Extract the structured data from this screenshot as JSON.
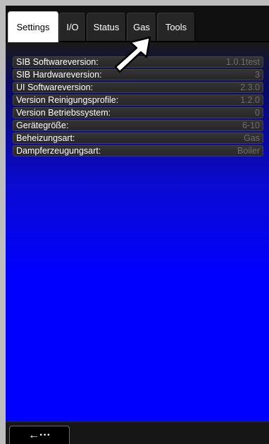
{
  "tabs": [
    {
      "label": "Settings",
      "active": true
    },
    {
      "label": "I/O",
      "active": false
    },
    {
      "label": "Status",
      "active": false
    },
    {
      "label": "Gas",
      "active": false
    },
    {
      "label": "Tools",
      "active": false
    }
  ],
  "info_rows": [
    {
      "label": "SIB Softwareversion:",
      "value": "1.0.1test"
    },
    {
      "label": "SIB Hardwareversion:",
      "value": "3"
    },
    {
      "label": "UI Softwareversion:",
      "value": "2.3.0"
    },
    {
      "label": "Version Reinigungsprofile:",
      "value": "1.2.0"
    },
    {
      "label": "Version Betriebssystem:",
      "value": "0"
    },
    {
      "label": "Gerätegröße:",
      "value": "6-10"
    },
    {
      "label": "Beheizungsart:",
      "value": "Gas"
    },
    {
      "label": "Dampferzeugungsart:",
      "value": "Boiler"
    }
  ],
  "bottom": {
    "back_label": "←···",
    "back_icon": "back-arrow-icon"
  },
  "colors": {
    "content_top": "#1a1a1a",
    "content_bottom": "#0000ff",
    "active_tab": "#ffffff",
    "value_text": "#6e6e6e"
  }
}
